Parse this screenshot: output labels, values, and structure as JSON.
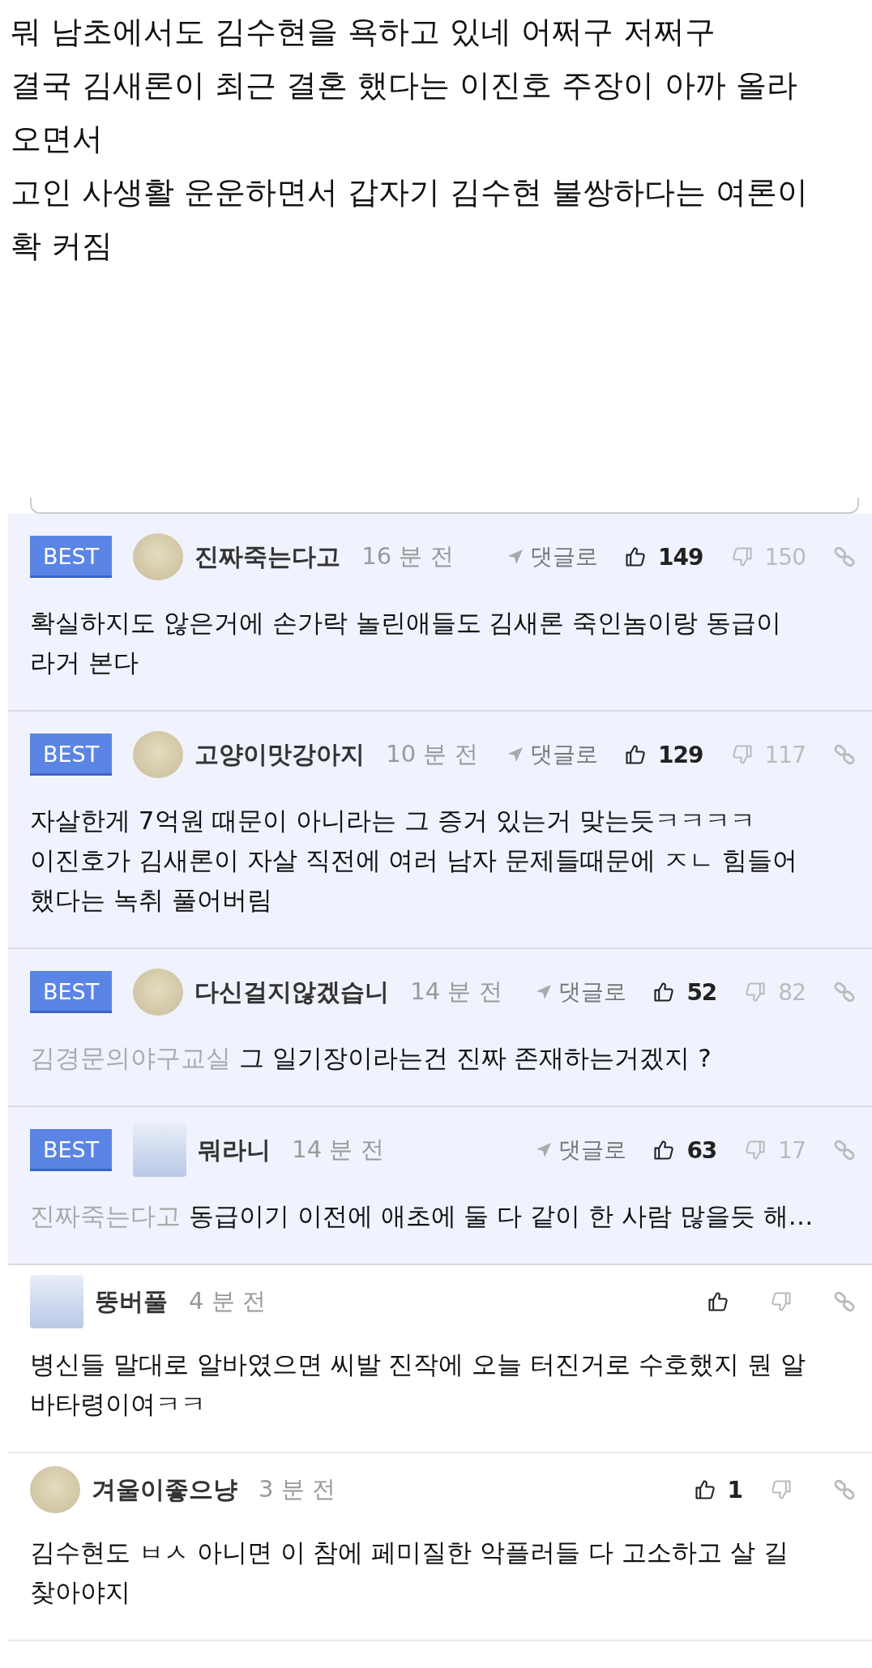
{
  "post": {
    "lines": [
      "뭐 남초에서도 김수현을 욕하고 있네 어쩌구 저쩌구",
      "결국 김새론이 최근 결혼 했다는 이진호 주장이 아까 올라",
      "오면서",
      "고인 사생활 운운하면서 갑자기 김수현 불쌍하다는 여론이",
      "확 커짐"
    ]
  },
  "comments": [
    {
      "best": true,
      "badge": "BEST",
      "kind": "round",
      "name": "진짜죽는다고",
      "time": "16 분 전",
      "reply": "댓글로",
      "up": "149",
      "down": "150",
      "lines": [
        "확실하지도 않은거에 손가락 놀린애들도 김새론 죽인놈이랑 동급이",
        "라거 본다"
      ]
    },
    {
      "best": true,
      "badge": "BEST",
      "kind": "round",
      "name": "고양이맛강아지",
      "time": "10 분 전",
      "reply": "댓글로",
      "up": "129",
      "down": "117",
      "lines": [
        "자살한게 7억원 때문이 아니라는 그 증거 있는거 맞는듯ㅋㅋㅋㅋ",
        "이진호가 김새론이 자살 직전에 여러 남자 문제들때문에 ㅈㄴ 힘들어",
        "했다는 녹취 풀어버림"
      ]
    },
    {
      "best": true,
      "badge": "BEST",
      "kind": "round",
      "name": "다신걸지않겠습니",
      "time": "14 분 전",
      "reply": "댓글로",
      "up": "52",
      "down": "82",
      "reply_to": "김경문의야구교실",
      "lines": [
        "그 일기장이라는건 진짜 존재하는거겠지 ?"
      ]
    },
    {
      "best": true,
      "badge": "BEST",
      "kind": "square",
      "name": "뭐라니",
      "time": "14 분 전",
      "reply": "댓글로",
      "up": "63",
      "down": "17",
      "reply_to": "진짜죽는다고",
      "lines": [
        "동급이기 이전에 애초에 둘 다 같이 한 사람 많을듯 해…"
      ]
    },
    {
      "best": false,
      "kind": "square",
      "name": "뚱버풀",
      "time": "4 분 전",
      "lines": [
        "병신들 말대로 알바였으면 씨발 진작에 오늘 터진거로 수호했지 뭔 알",
        "바타령이여ㅋㅋ"
      ]
    },
    {
      "best": false,
      "kind": "round",
      "name": "겨울이좋으냥",
      "time": "3 분 전",
      "up": "1",
      "lines": [
        "김수현도 ㅂㅅ 아니면 이 참에 페미질한 악플러들 다 고소하고 살 길",
        "찾아야지"
      ]
    }
  ]
}
